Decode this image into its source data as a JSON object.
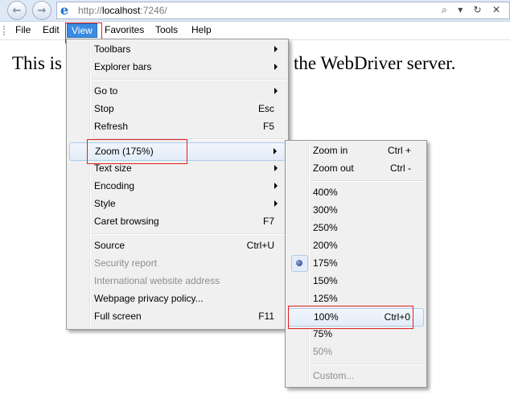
{
  "address_bar": {
    "url_prefix": "http://",
    "url_host": "localhost",
    "url_rest": ":7246/",
    "back_glyph": "←",
    "forward_glyph": "→",
    "controls": "⌕ ▾ ↻ ✕"
  },
  "menubar": [
    "File",
    "Edit",
    "View",
    "Favorites",
    "Tools",
    "Help"
  ],
  "page": {
    "text_left": "This is",
    "text_right": "the WebDriver server."
  },
  "view_menu": [
    {
      "label": "Toolbars",
      "submenu": true
    },
    {
      "label": "Explorer bars",
      "submenu": true
    },
    {
      "separator": true
    },
    {
      "label": "Go to",
      "submenu": true
    },
    {
      "label": "Stop",
      "shortcut": "Esc"
    },
    {
      "label": "Refresh",
      "shortcut": "F5"
    },
    {
      "separator": true
    },
    {
      "label": "Zoom (175%)",
      "submenu": true,
      "highlighted": true
    },
    {
      "label": "Text size",
      "submenu": true
    },
    {
      "label": "Encoding",
      "submenu": true
    },
    {
      "label": "Style",
      "submenu": true
    },
    {
      "label": "Caret browsing",
      "shortcut": "F7"
    },
    {
      "separator": true
    },
    {
      "label": "Source",
      "shortcut": "Ctrl+U"
    },
    {
      "label": "Security report",
      "disabled": true
    },
    {
      "label": "International website address",
      "disabled": true
    },
    {
      "label": "Webpage privacy policy..."
    },
    {
      "label": "Full screen",
      "shortcut": "F11"
    }
  ],
  "zoom_menu": [
    {
      "label": "Zoom in",
      "shortcut": "Ctrl +"
    },
    {
      "label": "Zoom out",
      "shortcut": "Ctrl -"
    },
    {
      "separator": true
    },
    {
      "label": "400%"
    },
    {
      "label": "300%"
    },
    {
      "label": "250%"
    },
    {
      "label": "200%"
    },
    {
      "label": "175%",
      "checked": true
    },
    {
      "label": "150%"
    },
    {
      "label": "125%"
    },
    {
      "label": "100%",
      "shortcut": "Ctrl+0",
      "highlighted": true
    },
    {
      "label": "75%"
    },
    {
      "label": "50%",
      "disabled": true
    },
    {
      "separator": true
    },
    {
      "label": "Custom...",
      "disabled": true
    }
  ],
  "colors": {
    "menu_active": "#3b8be2",
    "highlight_border": "#e02020",
    "menu_bg": "#f0f0f0"
  }
}
